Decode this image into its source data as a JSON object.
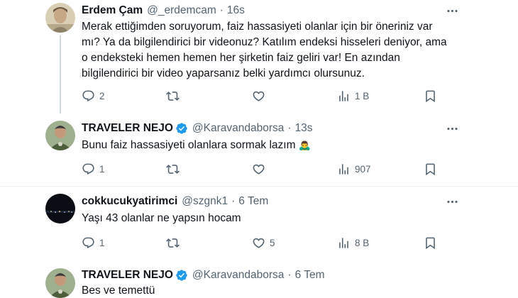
{
  "tweets": [
    {
      "name": "Erdem Çam",
      "handle": "@_erdemcam",
      "dot": "·",
      "time": "16s",
      "verified": false,
      "avatar": "avatar-photo-man-beige",
      "lines": [
        "Merak ettiğimden soruyorum, faiz hassasiyeti olanlar için bir öneriniz var",
        "mı? Ya da bilgilendirici bir videonuz? Katılım endeksi hisseleri deniyor, ama",
        "o endeksteki hemen hemen her şirketin faiz geliri var! En azından",
        "bilgilendirici bir video yaparsanız belki yardımcı olursunuz."
      ],
      "stats": {
        "replies": "2",
        "retweets": "",
        "likes": "",
        "views": "1 B"
      }
    },
    {
      "name": "TRAVELER NEJO",
      "handle": "@Karavandaborsa",
      "dot": "·",
      "time": "13s",
      "verified": true,
      "avatar": "avatar-photo-man-green-shirt",
      "lines": [
        "Bunu faiz hassasiyeti olanlara sormak lazım"
      ],
      "emoji": "🙇‍♂️",
      "stats": {
        "replies": "1",
        "retweets": "",
        "likes": "",
        "views": "907"
      }
    },
    {
      "name": "cokkucukyatirimci",
      "handle": "@szgnk1",
      "dot": "·",
      "time": "6 Tem",
      "verified": false,
      "avatar": "avatar-night-city",
      "lines": [
        "Yaşı 43 olanlar ne yapsın hocam"
      ],
      "stats": {
        "replies": "1",
        "retweets": "",
        "likes": "5",
        "views": "8 B"
      }
    },
    {
      "name": "TRAVELER NEJO",
      "handle": "@Karavandaborsa",
      "dot": "·",
      "time": "6 Tem",
      "verified": true,
      "avatar": "avatar-photo-man-green-shirt",
      "lines": [
        "Bes ve temettü"
      ]
    }
  ],
  "icons": {
    "reply": "reply-icon",
    "retweet": "retweet-icon",
    "like": "heart-icon",
    "views": "views-chart-icon",
    "bookmark": "bookmark-icon",
    "more": "more-dots-icon",
    "verified": "verified-badge-icon"
  },
  "colors": {
    "text": "#0f1419",
    "secondary": "#536471",
    "verified": "#1d9bf0",
    "thread_line": "#cfd9de",
    "separator": "#eff3f4"
  }
}
